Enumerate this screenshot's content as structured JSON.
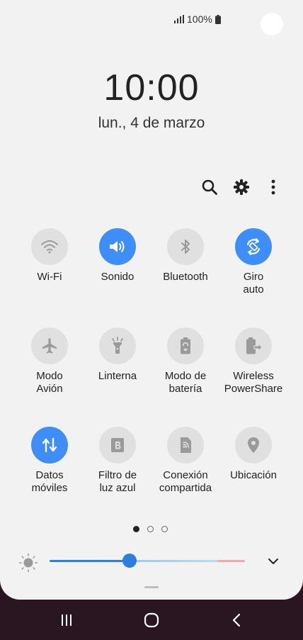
{
  "status": {
    "battery_text": "100%"
  },
  "clock": {
    "time": "10:00",
    "date": "lun., 4 de marzo"
  },
  "toolbar": {
    "search_icon": "search-icon",
    "settings_icon": "gear-icon",
    "more_icon": "more-vert-icon"
  },
  "tiles": [
    {
      "label": "Wi-Fi",
      "icon": "wifi-icon",
      "active": false
    },
    {
      "label": "Sonido",
      "icon": "volume-icon",
      "active": true
    },
    {
      "label": "Bluetooth",
      "icon": "bluetooth-icon",
      "active": false
    },
    {
      "label": "Giro\nauto",
      "icon": "auto-rotate-icon",
      "active": true
    },
    {
      "label": "Modo\nAvión",
      "icon": "airplane-icon",
      "active": false
    },
    {
      "label": "Linterna",
      "icon": "flashlight-icon",
      "active": false
    },
    {
      "label": "Modo de\nbatería",
      "icon": "battery-mode-icon",
      "active": false
    },
    {
      "label": "Wireless\nPowerShare",
      "icon": "wireless-powershare-icon",
      "active": false
    },
    {
      "label": "Datos\nmóviles",
      "icon": "mobile-data-icon",
      "active": true
    },
    {
      "label": "Filtro de\nluz azul",
      "icon": "blue-light-filter-icon",
      "active": false
    },
    {
      "label": "Conexión\ncompartida",
      "icon": "hotspot-icon",
      "active": false
    },
    {
      "label": "Ubicación",
      "icon": "location-icon",
      "active": false
    }
  ],
  "pager": {
    "pages": 3,
    "current": 1
  },
  "brightness": {
    "level": 0.41
  },
  "colors": {
    "accent": "#3e8ef7",
    "panel": "#f2f2f2",
    "navbar": "#2a1620"
  }
}
